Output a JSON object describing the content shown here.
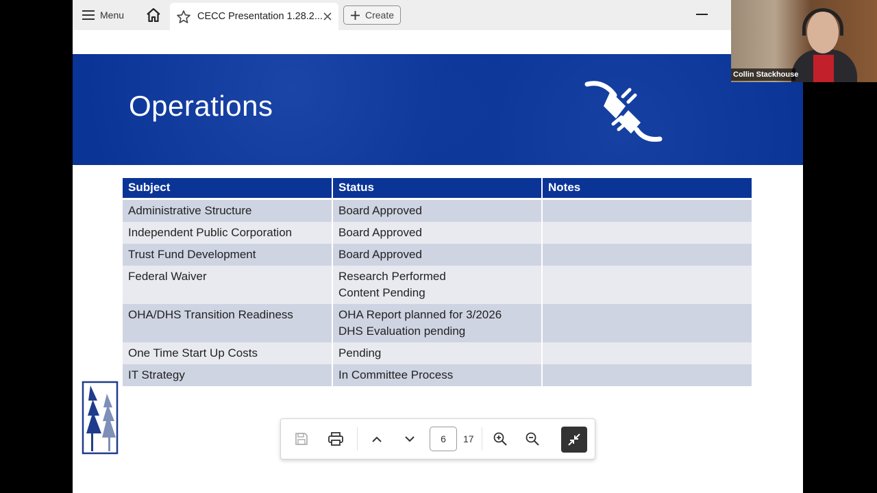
{
  "toolbar": {
    "menu_label": "Menu",
    "tab_title": "CECC Presentation 1.28.2...",
    "create_label": "Create"
  },
  "slide": {
    "title": "Operations",
    "table": {
      "headers": [
        "Subject",
        "Status",
        "Notes"
      ],
      "rows": [
        {
          "subject": "Administrative Structure",
          "status": [
            "Board Approved"
          ],
          "notes": ""
        },
        {
          "subject": "Independent Public Corporation",
          "status": [
            "Board Approved"
          ],
          "notes": ""
        },
        {
          "subject": "Trust Fund Development",
          "status": [
            "Board Approved"
          ],
          "notes": ""
        },
        {
          "subject": "Federal Waiver",
          "status": [
            "Research Performed",
            "Content Pending"
          ],
          "notes": ""
        },
        {
          "subject": "OHA/DHS Transition Readiness",
          "status": [
            "OHA Report planned for 3/2026",
            "DHS Evaluation pending"
          ],
          "notes": ""
        },
        {
          "subject": "One Time Start Up Costs",
          "status": [
            "Pending"
          ],
          "notes": ""
        },
        {
          "subject": "IT Strategy",
          "status": [
            "In Committee Process"
          ],
          "notes": ""
        }
      ]
    }
  },
  "pdf_toolbar": {
    "current_page": "6",
    "total_pages": "17"
  },
  "webcam": {
    "participant_name": "Collin Stackhouse"
  },
  "colors": {
    "brand_blue": "#0a3496",
    "row_dark": "#cfd4e2",
    "row_light": "#e8eaf0"
  }
}
